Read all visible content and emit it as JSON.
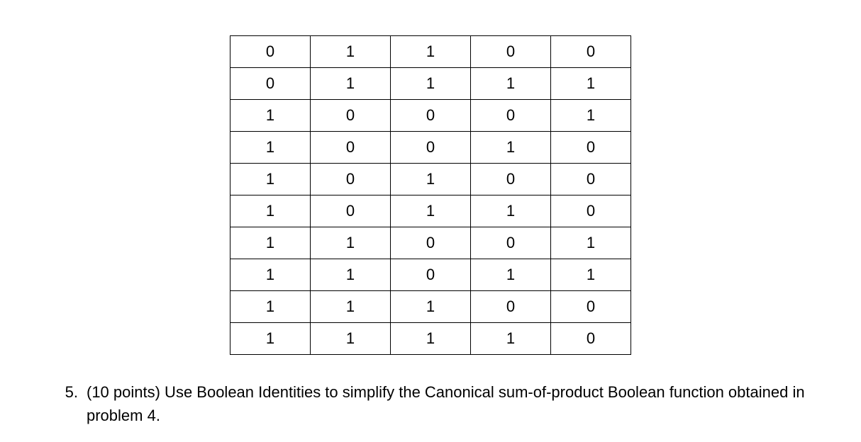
{
  "table": {
    "rows": [
      [
        "0",
        "1",
        "1",
        "0",
        "0"
      ],
      [
        "0",
        "1",
        "1",
        "1",
        "1"
      ],
      [
        "1",
        "0",
        "0",
        "0",
        "1"
      ],
      [
        "1",
        "0",
        "0",
        "1",
        "0"
      ],
      [
        "1",
        "0",
        "1",
        "0",
        "0"
      ],
      [
        "1",
        "0",
        "1",
        "1",
        "0"
      ],
      [
        "1",
        "1",
        "0",
        "0",
        "1"
      ],
      [
        "1",
        "1",
        "0",
        "1",
        "1"
      ],
      [
        "1",
        "1",
        "1",
        "0",
        "0"
      ],
      [
        "1",
        "1",
        "1",
        "1",
        "0"
      ]
    ]
  },
  "question": {
    "number": "5.",
    "text": "(10 points) Use Boolean Identities to simplify the Canonical sum-of-product Boolean function obtained in problem 4."
  }
}
